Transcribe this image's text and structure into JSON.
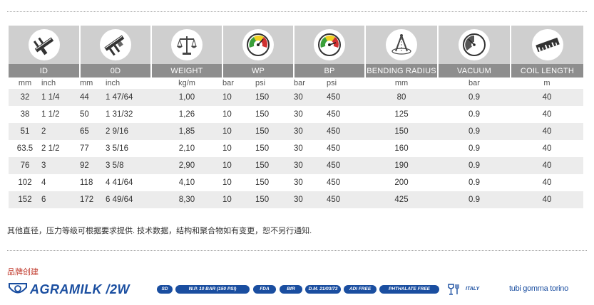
{
  "table": {
    "headers": {
      "id": "ID",
      "od": "0D",
      "weight": "WEIGHT",
      "wp": "WP",
      "bp": "BP",
      "bending_radius": "BENDING RADIUS",
      "vacuum": "VACUUM",
      "coil_length": "COIL LENGTH"
    },
    "units": {
      "id_mm": "mm",
      "id_inch": "inch",
      "od_mm": "mm",
      "od_inch": "inch",
      "weight": "kg/m",
      "wp_bar": "bar",
      "wp_psi": "psi",
      "bp_bar": "bar",
      "bp_psi": "psi",
      "bending_radius": "mm",
      "vacuum": "bar",
      "coil_length": "m"
    },
    "rows": [
      [
        "32",
        "1 1/4",
        "44",
        "1 47/64",
        "1,00",
        "10",
        "150",
        "30",
        "450",
        "80",
        "0.9",
        "40"
      ],
      [
        "38",
        "1 1/2",
        "50",
        "1 31/32",
        "1,26",
        "10",
        "150",
        "30",
        "450",
        "125",
        "0.9",
        "40"
      ],
      [
        "51",
        "2",
        "65",
        "2 9/16",
        "1,85",
        "10",
        "150",
        "30",
        "450",
        "150",
        "0.9",
        "40"
      ],
      [
        "63.5",
        "2 1/2",
        "77",
        "3 5/16",
        "2,10",
        "10",
        "150",
        "30",
        "450",
        "160",
        "0.9",
        "40"
      ],
      [
        "76",
        "3",
        "92",
        "3 5/8",
        "2,90",
        "10",
        "150",
        "30",
        "450",
        "190",
        "0.9",
        "40"
      ],
      [
        "102",
        "4",
        "118",
        "4 41/64",
        "4,10",
        "10",
        "150",
        "30",
        "450",
        "200",
        "0.9",
        "40"
      ],
      [
        "152",
        "6",
        "172",
        "6 49/64",
        "8,30",
        "10",
        "150",
        "30",
        "450",
        "425",
        "0.9",
        "40"
      ]
    ]
  },
  "icons": [
    "caliper-id-icon",
    "caliper-od-icon",
    "scale-icon",
    "pressure-gauge-wp-icon",
    "pressure-gauge-bp-icon",
    "bending-compass-icon",
    "vacuum-gauge-icon",
    "coil-ruler-icon"
  ],
  "note": "其他直径，压力等级可根据要求提供. 技术数据，结构和聚合物如有变更，恕不另行通知.",
  "brand_label": "品牌创建",
  "footer": {
    "product_name": "AGRAMILK /2W",
    "badges": [
      "SD",
      "W.P. 10 BAR (150 PSI)",
      "FDA",
      "BfR",
      "D.M. 21/03/73",
      "ADI FREE",
      "PHTHALATE FREE"
    ],
    "italy": "ITALY",
    "company": "tubi gomma torino"
  },
  "colors": {
    "header_light": "#cfcfcf",
    "header_dark": "#8e8e8e",
    "row_alt": "#ececec",
    "brand_blue": "#1a4ea0",
    "brand_label_red": "#c0392b"
  }
}
